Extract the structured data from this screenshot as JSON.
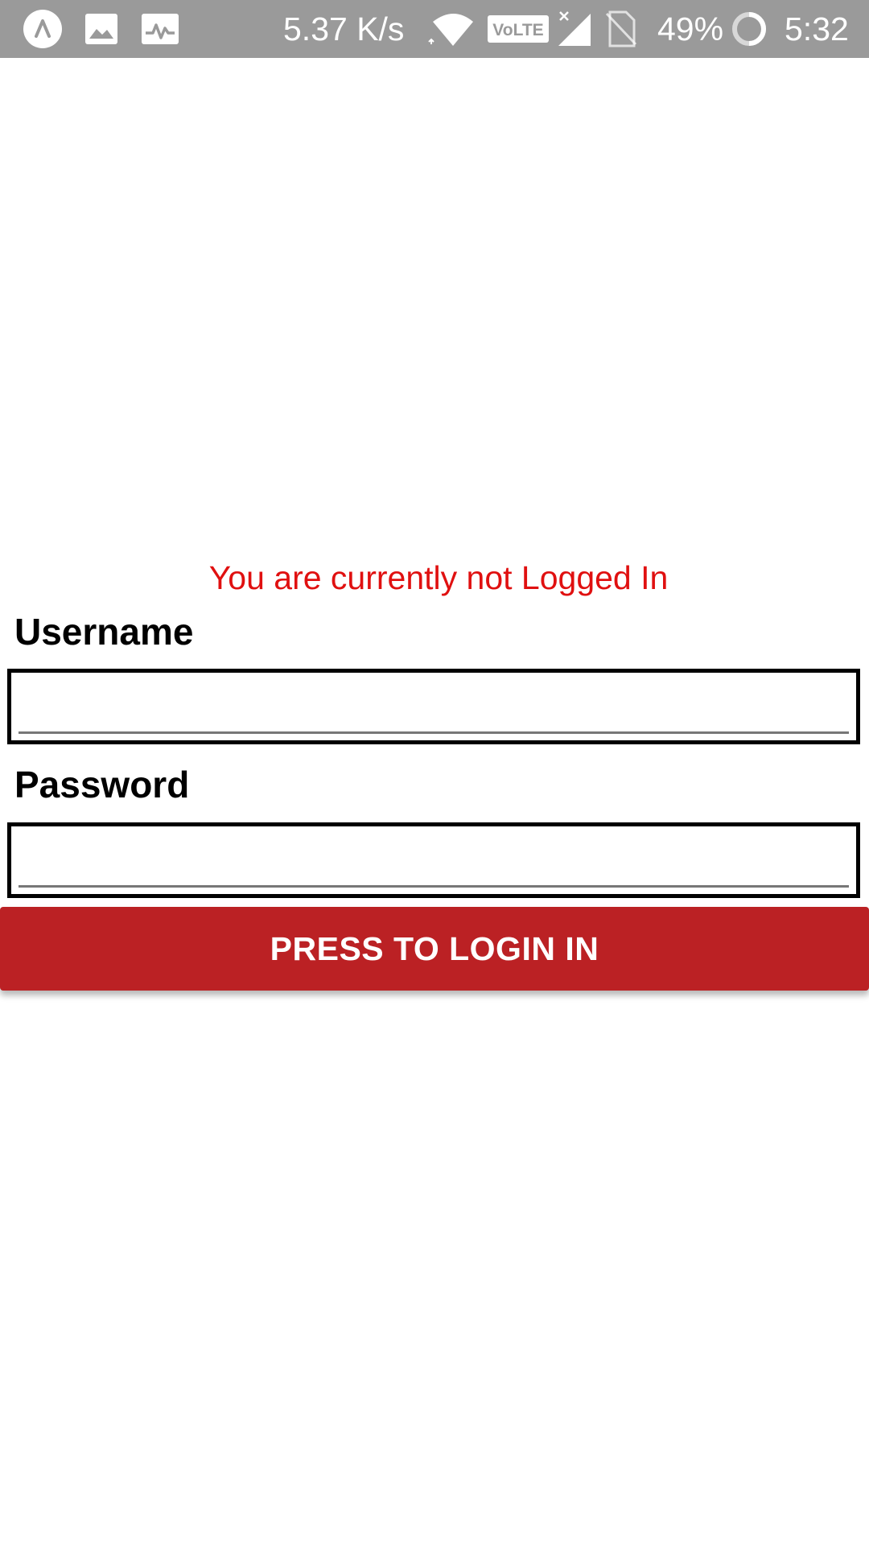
{
  "status_bar": {
    "notification_icons": [
      "app-launcher-icon",
      "image-icon",
      "activity-icon"
    ],
    "net_speed": "5.37 K/s",
    "volte_label": "VoLTE",
    "battery_percent": "49%",
    "time": "5:32",
    "background_color": "#9a9a9a"
  },
  "login": {
    "status_message": "You are currently not Logged In",
    "status_color": "#e01010",
    "username_label": "Username",
    "username_value": "",
    "password_label": "Password",
    "password_value": "",
    "button_label": "PRESS TO LOGIN IN",
    "button_color": "#bb2124"
  }
}
